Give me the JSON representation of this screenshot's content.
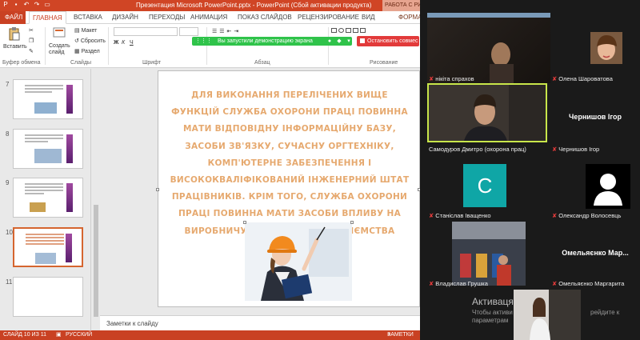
{
  "window": {
    "title": "Презентация Microsoft PowerPoint.pptx - PowerPoint (Сбой активации продукта)",
    "context_tab": "РАБОТА С РИС"
  },
  "tabs": [
    {
      "label": "ФАЙЛ"
    },
    {
      "label": "ГЛАВНАЯ"
    },
    {
      "label": "ВСТАВКА"
    },
    {
      "label": "ДИЗАЙН"
    },
    {
      "label": "ПЕРЕХОДЫ"
    },
    {
      "label": "АНИМАЦИЯ"
    },
    {
      "label": "ПОКАЗ СЛАЙДОВ"
    },
    {
      "label": "РЕЦЕНЗИРОВАНИЕ"
    },
    {
      "label": "ВИД"
    },
    {
      "label": "ФОРМА"
    }
  ],
  "ribbon": {
    "paste": "Вставить",
    "create_slide": "Создать слайд",
    "layout": "Макет",
    "reset": "Сбросить",
    "section": "Раздел",
    "group_clipboard": "Буфер обмена",
    "group_slides": "Слайды",
    "group_font": "Шрифт",
    "group_paragraph": "Абзац",
    "group_drawing": "Рисование"
  },
  "share_bar": {
    "text": "Вы запустили демонстрацию экрана",
    "stop": "Остановить совмес"
  },
  "slides_panel": [
    {
      "num": "7"
    },
    {
      "num": "8"
    },
    {
      "num": "9"
    },
    {
      "num": "10"
    },
    {
      "num": "11"
    }
  ],
  "slide": {
    "text": "Для виконання перелічених вище функцій служба охорони праці повинна мати відповідну інформаційну базу, засоби зв'язку, сучасну оргтехніку, комп'ютерне забезпечення і висококваліфікований інженерний штат працівників. Крім того, служба охорони праці повинна мати засоби впливу на виробничу діяльність підприємства"
  },
  "notes": "Заметки к слайду",
  "status": {
    "slide": "СЛАЙД 10 ИЗ 11",
    "lang": "РУССКИЙ",
    "notes": "ЗАМЕТКИ"
  },
  "participants": [
    {
      "name": "нікіта спрахов"
    },
    {
      "name": "Олена Шароватова"
    },
    {
      "name": "Самодуров Дмитро (охорона прац)"
    },
    {
      "name": "Чернишов Ігор",
      "big": "Чернишов Ігор"
    },
    {
      "name": "Станіслав Іващенко",
      "initial": "C"
    },
    {
      "name": "Олександр Волосевць"
    },
    {
      "name": "Владислав Грушка"
    },
    {
      "name": "Омельяєнко Маргарита",
      "big": "Омельяєнко Мар..."
    }
  ],
  "activation": {
    "title": "Активаця",
    "sub_left": "Чтобы активи",
    "sub_right": "рейдите к",
    "sub2": "параметрам"
  },
  "colors": {
    "ppt_accent": "#c94123",
    "share_green": "#2fc34a",
    "stop_red": "#e23a3a",
    "slide_text": "#e6a96f",
    "active_speaker": "#c8e64a",
    "initial_tile": "#0fa6a6"
  }
}
